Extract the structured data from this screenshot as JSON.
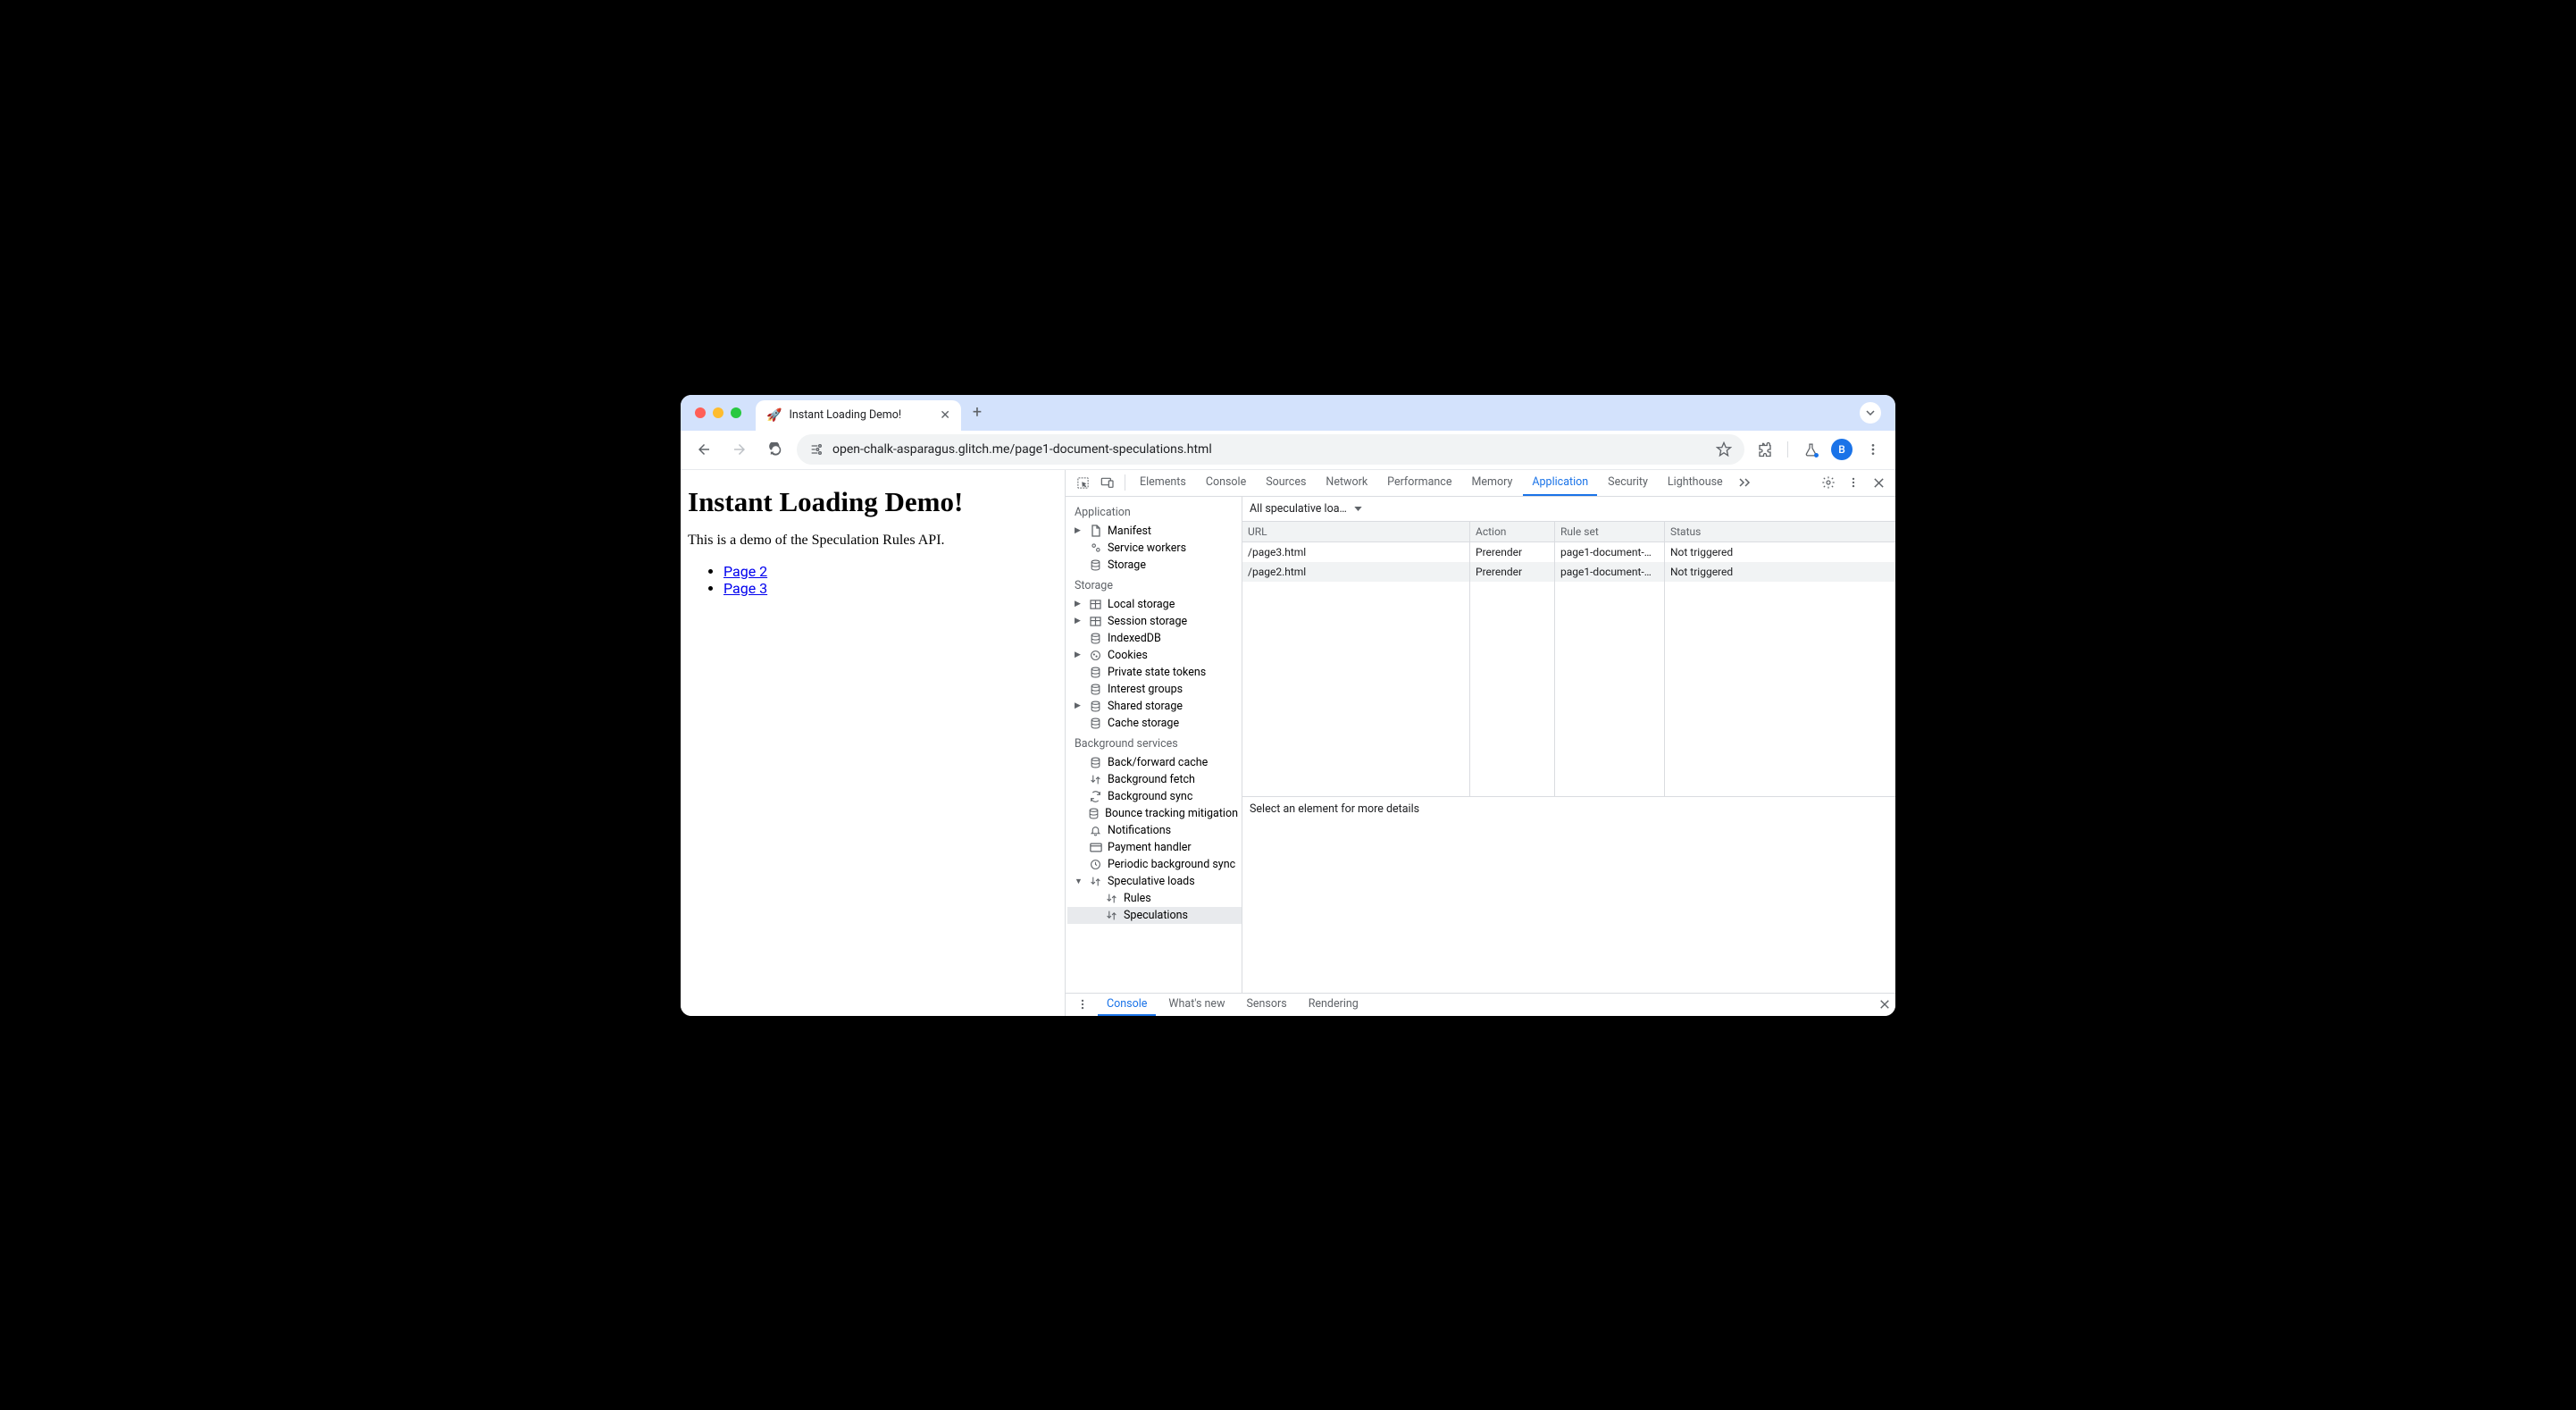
{
  "browser": {
    "tab_title": "Instant Loading Demo!",
    "favicon": "🚀",
    "url": "open-chalk-asparagus.glitch.me/page1-document-speculations.html",
    "avatar_letter": "B"
  },
  "page": {
    "heading": "Instant Loading Demo!",
    "paragraph": "This is a demo of the Speculation Rules API.",
    "links": [
      "Page 2",
      "Page 3"
    ]
  },
  "devtools": {
    "tabs": [
      "Elements",
      "Console",
      "Sources",
      "Network",
      "Performance",
      "Memory",
      "Application",
      "Security",
      "Lighthouse"
    ],
    "active_tab": "Application",
    "sidebar": {
      "sections": [
        {
          "title": "Application",
          "items": [
            {
              "label": "Manifest",
              "icon": "file",
              "expandable": true
            },
            {
              "label": "Service workers",
              "icon": "gears"
            },
            {
              "label": "Storage",
              "icon": "db"
            }
          ]
        },
        {
          "title": "Storage",
          "items": [
            {
              "label": "Local storage",
              "icon": "grid",
              "expandable": true
            },
            {
              "label": "Session storage",
              "icon": "grid",
              "expandable": true
            },
            {
              "label": "IndexedDB",
              "icon": "db"
            },
            {
              "label": "Cookies",
              "icon": "cookie",
              "expandable": true
            },
            {
              "label": "Private state tokens",
              "icon": "db"
            },
            {
              "label": "Interest groups",
              "icon": "db"
            },
            {
              "label": "Shared storage",
              "icon": "db",
              "expandable": true
            },
            {
              "label": "Cache storage",
              "icon": "db"
            }
          ]
        },
        {
          "title": "Background services",
          "items": [
            {
              "label": "Back/forward cache",
              "icon": "db"
            },
            {
              "label": "Background fetch",
              "icon": "updown"
            },
            {
              "label": "Background sync",
              "icon": "sync"
            },
            {
              "label": "Bounce tracking mitigation",
              "icon": "db"
            },
            {
              "label": "Notifications",
              "icon": "bell"
            },
            {
              "label": "Payment handler",
              "icon": "card"
            },
            {
              "label": "Periodic background sync",
              "icon": "clock"
            },
            {
              "label": "Speculative loads",
              "icon": "updown",
              "expandable": true,
              "expanded": true,
              "children": [
                {
                  "label": "Rules",
                  "icon": "updown"
                },
                {
                  "label": "Speculations",
                  "icon": "updown",
                  "selected": true
                }
              ]
            }
          ]
        }
      ]
    },
    "main": {
      "dropdown": "All speculative loa…",
      "columns": [
        "URL",
        "Action",
        "Rule set",
        "Status"
      ],
      "rows": [
        {
          "url": "/page3.html",
          "action": "Prerender",
          "rule": "page1-document-…",
          "status": "Not triggered"
        },
        {
          "url": "/page2.html",
          "action": "Prerender",
          "rule": "page1-document-…",
          "status": "Not triggered"
        }
      ],
      "detail": "Select an element for more details"
    },
    "drawer": {
      "tabs": [
        "Console",
        "What's new",
        "Sensors",
        "Rendering"
      ],
      "active": "Console"
    }
  }
}
